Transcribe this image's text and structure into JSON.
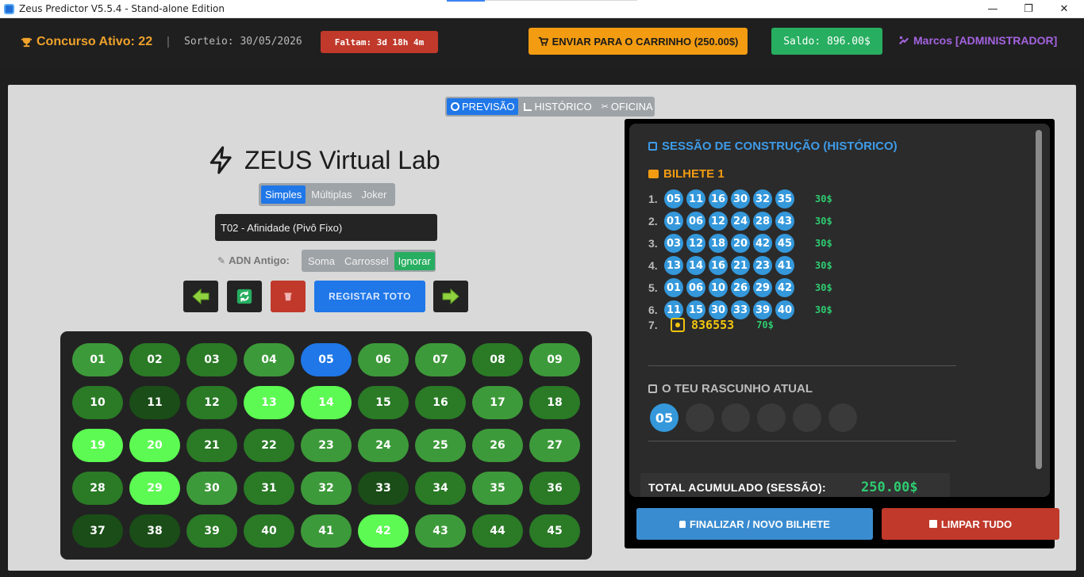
{
  "window": {
    "title": "Zeus Predictor V5.5.4 - Stand-alone Edition",
    "controls": {
      "minimize": "—",
      "maximize": "❐",
      "close": "✕"
    }
  },
  "header": {
    "concurso": "Concurso Ativo: 22",
    "separator": "|",
    "sorteio": "Sorteio: 30/05/2026",
    "faltam": "Faltam: 3d 18h 4m",
    "carrinho_button": "ENVIAR PARA O CARRINHO (250.00$)",
    "saldo": "Saldo: 896.00$",
    "user": "Marcos [ADMINISTRADOR]"
  },
  "tabs": [
    {
      "label": "PREVISÃO",
      "icon": "target-icon",
      "active": true
    },
    {
      "label": "HISTÓRICO",
      "icon": "chart-icon",
      "active": false
    },
    {
      "label": "OFICINA",
      "icon": "tools-icon",
      "active": false
    }
  ],
  "lab": {
    "title": "ZEUS Virtual Lab",
    "modes": [
      {
        "label": "Simples",
        "active": true
      },
      {
        "label": "Múltiplas",
        "active": false
      },
      {
        "label": "Joker",
        "active": false
      }
    ],
    "strategy_value": "T02 - Afinidade (Pivô Fixo)",
    "adn_label": "ADN Antigo:",
    "adn_options": [
      {
        "label": "Soma",
        "active": false
      },
      {
        "label": "Carrossel",
        "active": false
      },
      {
        "label": "Ignorar",
        "active": true
      }
    ],
    "registar_label": "REGISTAR TOTO"
  },
  "grid": {
    "numbers": [
      {
        "n": "01",
        "c": "#3d9a3a"
      },
      {
        "n": "02",
        "c": "#2a7a26"
      },
      {
        "n": "03",
        "c": "#2a7a26"
      },
      {
        "n": "04",
        "c": "#3d9a3a"
      },
      {
        "n": "05",
        "c": "#1f77e8"
      },
      {
        "n": "06",
        "c": "#3d9a3a"
      },
      {
        "n": "07",
        "c": "#3d9a3a"
      },
      {
        "n": "08",
        "c": "#2a7a26"
      },
      {
        "n": "09",
        "c": "#3d9a3a"
      },
      {
        "n": "10",
        "c": "#2a7a26"
      },
      {
        "n": "11",
        "c": "#1a4d17"
      },
      {
        "n": "12",
        "c": "#2a7a26"
      },
      {
        "n": "13",
        "c": "#5cfa52"
      },
      {
        "n": "14",
        "c": "#5cfa52"
      },
      {
        "n": "15",
        "c": "#2a7a26"
      },
      {
        "n": "16",
        "c": "#2a7a26"
      },
      {
        "n": "17",
        "c": "#3d9a3a"
      },
      {
        "n": "18",
        "c": "#2a7a26"
      },
      {
        "n": "19",
        "c": "#5cfa52"
      },
      {
        "n": "20",
        "c": "#5cfa52"
      },
      {
        "n": "21",
        "c": "#2a7a26"
      },
      {
        "n": "22",
        "c": "#2a7a26"
      },
      {
        "n": "23",
        "c": "#3d9a3a"
      },
      {
        "n": "24",
        "c": "#3d9a3a"
      },
      {
        "n": "25",
        "c": "#3d9a3a"
      },
      {
        "n": "26",
        "c": "#3d9a3a"
      },
      {
        "n": "27",
        "c": "#3d9a3a"
      },
      {
        "n": "28",
        "c": "#2a7a26"
      },
      {
        "n": "29",
        "c": "#5cfa52"
      },
      {
        "n": "30",
        "c": "#3d9a3a"
      },
      {
        "n": "31",
        "c": "#2a7a26"
      },
      {
        "n": "32",
        "c": "#3d9a3a"
      },
      {
        "n": "33",
        "c": "#1a4d17"
      },
      {
        "n": "34",
        "c": "#2a7a26"
      },
      {
        "n": "35",
        "c": "#3d9a3a"
      },
      {
        "n": "36",
        "c": "#2a7a26"
      },
      {
        "n": "37",
        "c": "#1a4d17"
      },
      {
        "n": "38",
        "c": "#1a4d17"
      },
      {
        "n": "39",
        "c": "#2a7a26"
      },
      {
        "n": "40",
        "c": "#2a7a26"
      },
      {
        "n": "41",
        "c": "#3d9a3a"
      },
      {
        "n": "42",
        "c": "#5cfa52"
      },
      {
        "n": "43",
        "c": "#3d9a3a"
      },
      {
        "n": "44",
        "c": "#2a7a26"
      },
      {
        "n": "45",
        "c": "#2a7a26"
      }
    ]
  },
  "session": {
    "title": "SESSÃO DE CONSTRUÇÃO (HISTÓRICO)",
    "bilhete_title": "BILHETE 1",
    "rows": [
      {
        "idx": "1.",
        "balls": [
          "05",
          "11",
          "16",
          "30",
          "32",
          "35"
        ],
        "price": "30$"
      },
      {
        "idx": "2.",
        "balls": [
          "01",
          "06",
          "12",
          "24",
          "28",
          "43"
        ],
        "price": "30$"
      },
      {
        "idx": "3.",
        "balls": [
          "03",
          "12",
          "18",
          "20",
          "42",
          "45"
        ],
        "price": "30$"
      },
      {
        "idx": "4.",
        "balls": [
          "13",
          "14",
          "16",
          "21",
          "23",
          "41"
        ],
        "price": "30$"
      },
      {
        "idx": "5.",
        "balls": [
          "01",
          "06",
          "10",
          "26",
          "29",
          "42"
        ],
        "price": "30$"
      },
      {
        "idx": "6.",
        "balls": [
          "11",
          "15",
          "30",
          "33",
          "39",
          "40"
        ],
        "price": "30$"
      }
    ],
    "joker_row": {
      "idx": "7.",
      "number": "836553",
      "price": "70$"
    },
    "rascunho_title": "O TEU RASCUNHO ATUAL",
    "draft": [
      "05",
      "",
      "",
      "",
      "",
      ""
    ],
    "total_label": "TOTAL ACUMULADO (SESSÃO):",
    "total_value": "250.00$",
    "finalizar_label": "FINALIZAR / NOVO BILHETE",
    "limpar_label": "LIMPAR TUDO"
  },
  "colors": {
    "accent_blue": "#1f77e8",
    "danger": "#c0392b",
    "success": "#27ae60",
    "warning": "#f39c12",
    "user_purple": "#a463e0"
  }
}
